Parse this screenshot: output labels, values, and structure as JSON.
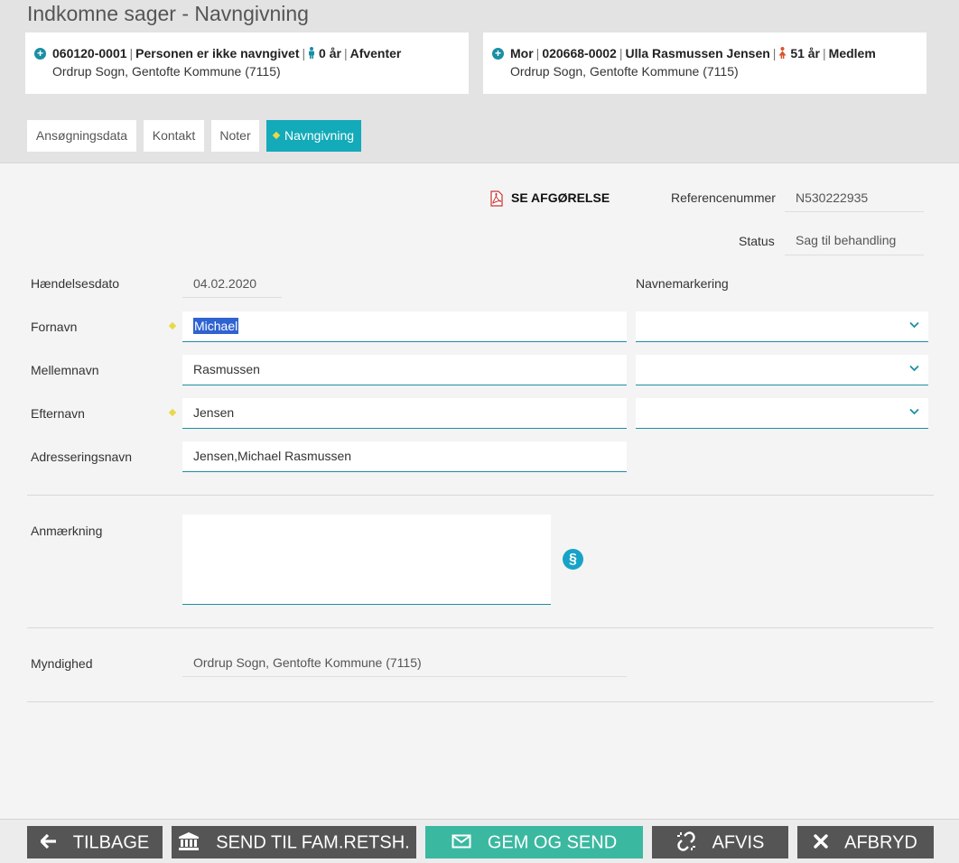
{
  "page_title": "Indkomne sager - Navngivning",
  "cards": {
    "child": {
      "cpr": "060120-0001",
      "name": "Personen er ikke navngivet",
      "age": "0 år",
      "status": "Afventer",
      "parish": "Ordrup Sogn, Gentofte Kommune (7115)",
      "gender_color": "#1a8fa3"
    },
    "mother": {
      "role": "Mor",
      "cpr": "020668-0002",
      "name": "Ulla Rasmussen Jensen",
      "age": "51 år",
      "status": "Medlem",
      "parish": "Ordrup Sogn, Gentofte Kommune (7115)",
      "gender_color": "#d9532c"
    }
  },
  "tabs": [
    {
      "label": "Ansøgningsdata"
    },
    {
      "label": "Kontakt"
    },
    {
      "label": "Noter"
    },
    {
      "label": "Navngivning"
    }
  ],
  "decision_link": "SE AFGØRELSE",
  "reference": {
    "label": "Referencenummer",
    "value": "N530222935"
  },
  "status": {
    "label": "Status",
    "value": "Sag til behandling"
  },
  "event_date": {
    "label": "Hændelsesdato",
    "value": "04.02.2020"
  },
  "name_marking_label": "Navnemarkering",
  "first_name": {
    "label": "Fornavn",
    "value": "Michael"
  },
  "middle_name": {
    "label": "Mellemnavn",
    "value": "Rasmussen"
  },
  "last_name": {
    "label": "Efternavn",
    "value": "Jensen"
  },
  "address_name": {
    "label": "Adresseringsnavn",
    "value": "Jensen,Michael Rasmussen"
  },
  "remark": {
    "label": "Anmærkning",
    "value": ""
  },
  "paragraph_symbol": "§",
  "authority": {
    "label": "Myndighed",
    "value": "Ordrup Sogn, Gentofte Kommune (7115)"
  },
  "buttons": {
    "back": "TILBAGE",
    "send_fam": "SEND TIL FAM.RETSH.",
    "save_send": "GEM OG SEND",
    "reject": "AFVIS",
    "cancel": "AFBRYD"
  },
  "colors": {
    "accent": "#13aab9",
    "primary_button": "#3bb8a0",
    "dark_button": "#555555",
    "required_marker": "#e8d94a"
  }
}
